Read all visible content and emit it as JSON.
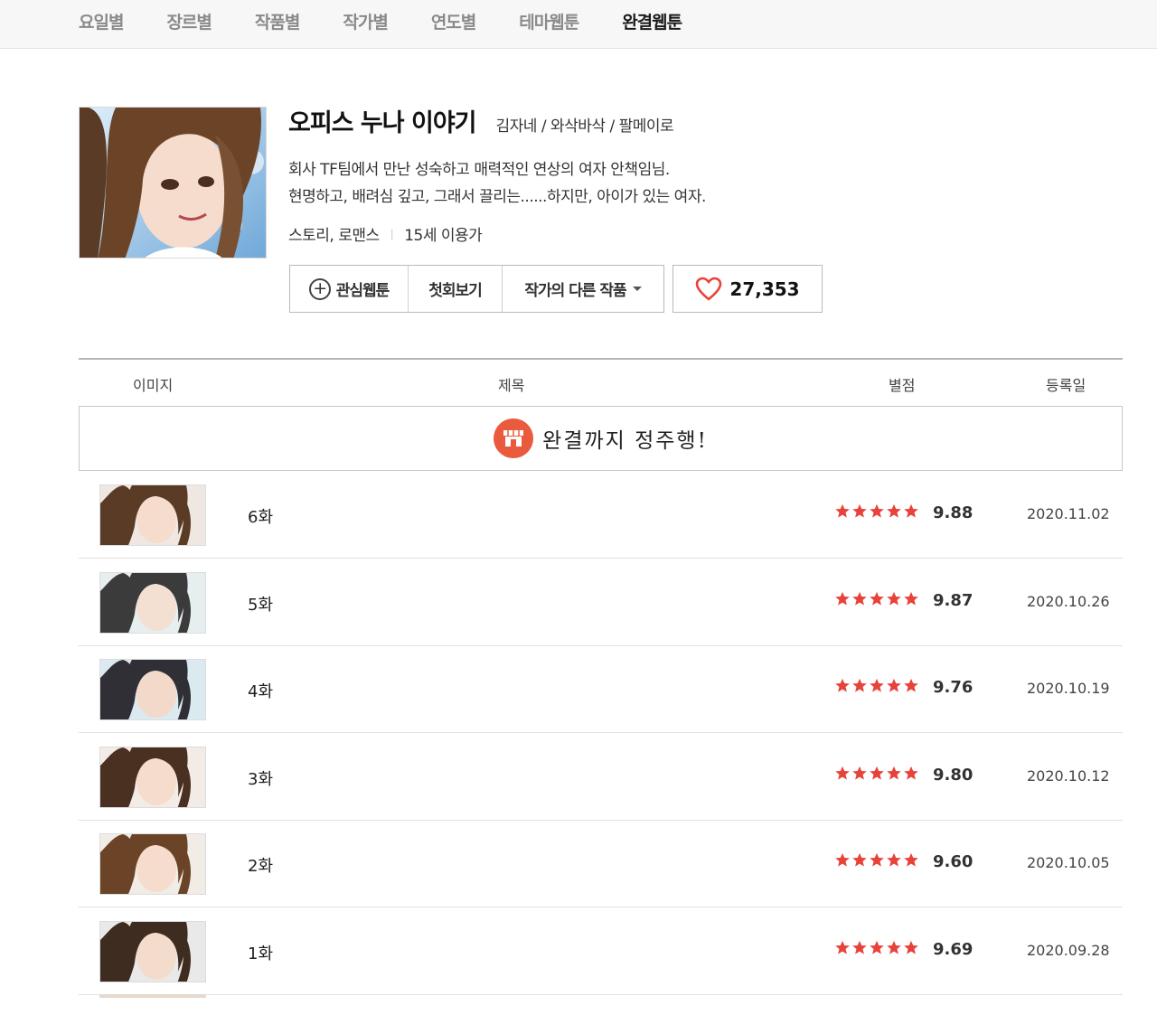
{
  "nav": {
    "items": [
      "요일별",
      "장르별",
      "작품별",
      "작가별",
      "연도별",
      "테마웹툰",
      "완결웹툰"
    ],
    "active_index": 6
  },
  "comic": {
    "title": "오피스 누나 이야기",
    "authors": "김자네 / 와삭바삭 / 팔메이로",
    "synopsis": [
      "회사 TF팀에서 만난 성숙하고 매력적인 연상의 여자 안책임님.",
      "현명하고, 배려심 깊고, 그래서 끌리는......하지만, 아이가 있는 여자."
    ],
    "genre": "스토리, 로맨스",
    "age": "15세 이용가",
    "buttons": {
      "favorite": "관심웹툰",
      "first_episode": "첫회보기",
      "other_works": "작가의 다른 작품"
    },
    "likes": "27,353"
  },
  "table": {
    "headers": [
      "이미지",
      "제목",
      "별점",
      "등록일"
    ],
    "banner_text": "완결까지 정주행!",
    "episodes": [
      {
        "title": "6화",
        "score": "9.88",
        "date": "2020.11.02"
      },
      {
        "title": "5화",
        "score": "9.87",
        "date": "2020.10.26"
      },
      {
        "title": "4화",
        "score": "9.76",
        "date": "2020.10.19"
      },
      {
        "title": "3화",
        "score": "9.80",
        "date": "2020.10.12"
      },
      {
        "title": "2화",
        "score": "9.60",
        "date": "2020.10.05"
      },
      {
        "title": "1화",
        "score": "9.69",
        "date": "2020.09.28"
      }
    ]
  },
  "colors": {
    "star": "#e8433b",
    "heart": "#e8433b",
    "banner_icon": "#ea5a3c",
    "active_nav": "#1a1a1a",
    "inactive_nav": "#8a8a8a"
  },
  "icons": {
    "favorite": "plus-circle-icon",
    "like": "heart-icon",
    "rating": "star-icon",
    "banner": "store-icon",
    "dropdown": "caret-down-icon"
  }
}
